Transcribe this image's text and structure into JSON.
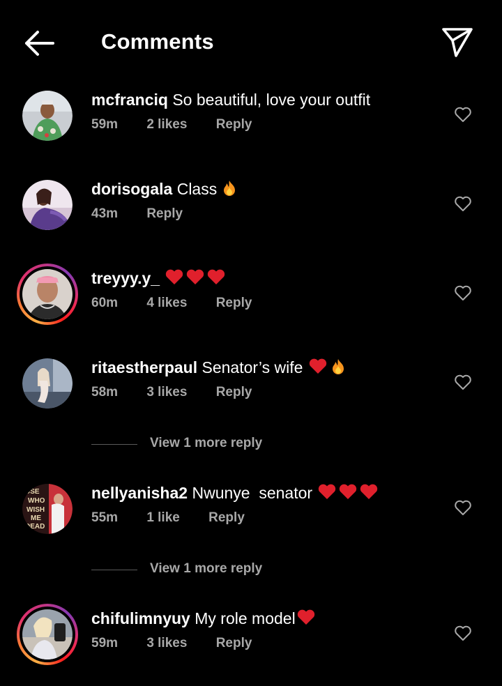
{
  "header": {
    "title": "Comments"
  },
  "comments": [
    {
      "username": "mcfranciq",
      "text": "So beautiful, love your outfit",
      "emoji": "",
      "time": "59m",
      "likes": "2 likes",
      "reply": "Reply",
      "story": false
    },
    {
      "username": "dorisogala",
      "text": "Class",
      "emoji": "fire",
      "time": "43m",
      "likes": "",
      "reply": "Reply",
      "story": false
    },
    {
      "username": "treyyy.y_",
      "text": "",
      "emoji": "hearts3",
      "time": "60m",
      "likes": "4 likes",
      "reply": "Reply",
      "story": true
    },
    {
      "username": "ritaestherpaul",
      "text": "Senator’s wife",
      "emoji": "heart-fire",
      "time": "58m",
      "likes": "3 likes",
      "reply": "Reply",
      "story": false
    },
    {
      "username": "nellyanisha2",
      "text": "Nwunye  senator",
      "emoji": "hearts3",
      "time": "55m",
      "likes": "1 like",
      "reply": "Reply",
      "story": false
    },
    {
      "username": "chifulimnyuy",
      "text": "My role model",
      "emoji": "heart1",
      "time": "59m",
      "likes": "3 likes",
      "reply": "Reply",
      "story": true
    }
  ],
  "view_more": [
    {
      "label": "View 1 more reply"
    },
    {
      "label": "View 1 more reply"
    }
  ],
  "avatar_text": {
    "nellyanisha2": "USE WHO WISH ME DEAD"
  },
  "colors": {
    "background": "#000000",
    "text": "#ffffff",
    "meta": "#a8a8a8",
    "heart_red": "#e0202c"
  }
}
